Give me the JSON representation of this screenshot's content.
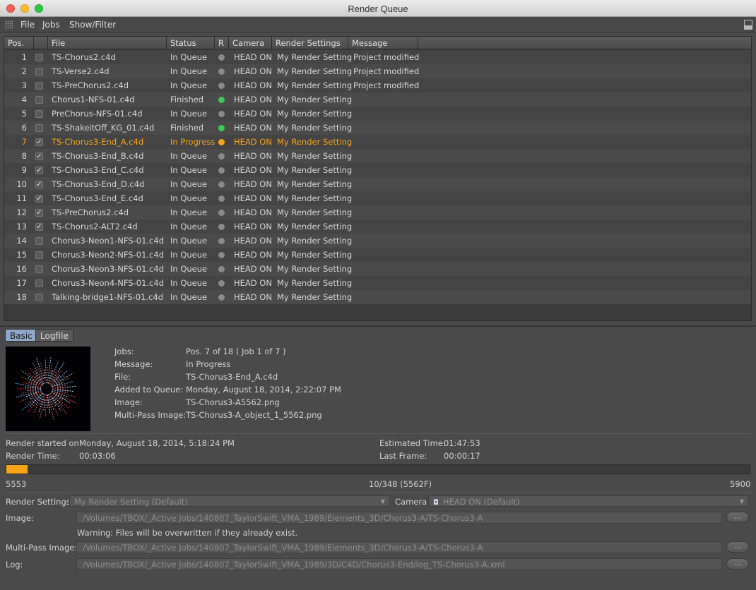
{
  "window": {
    "title": "Render Queue"
  },
  "menu": [
    "File",
    "Jobs",
    "Show/Filter"
  ],
  "columns": {
    "pos": "Pos.",
    "file": "File",
    "status": "Status",
    "r": "R",
    "camera": "Camera",
    "render_settings": "Render Settings",
    "message": "Message"
  },
  "colors": {
    "finished": "#3ec95a",
    "in_progress": "#f8a417",
    "queued": "#8a8a8a",
    "highlight": "#f8a417"
  },
  "jobs": [
    {
      "pos": "1",
      "checked": false,
      "file": "TS-Chorus2.c4d",
      "status": "In Queue",
      "state": "queued",
      "camera": "HEAD ON",
      "render_setting": "My Render Setting",
      "message": "Project modified"
    },
    {
      "pos": "2",
      "checked": false,
      "file": "TS-Verse2.c4d",
      "status": "In Queue",
      "state": "queued",
      "camera": "HEAD ON",
      "render_setting": "My Render Setting",
      "message": "Project modified"
    },
    {
      "pos": "3",
      "checked": false,
      "file": "TS-PreChorus2.c4d",
      "status": "In Queue",
      "state": "queued",
      "camera": "HEAD ON",
      "render_setting": "My Render Setting",
      "message": "Project modified"
    },
    {
      "pos": "4",
      "checked": false,
      "file": "Chorus1-NFS-01.c4d",
      "status": "Finished",
      "state": "finished",
      "camera": "HEAD ON",
      "render_setting": "My Render Setting",
      "message": ""
    },
    {
      "pos": "5",
      "checked": false,
      "file": "PreChorus-NFS-01.c4d",
      "status": "In Queue",
      "state": "queued",
      "camera": "HEAD ON",
      "render_setting": "My Render Setting",
      "message": ""
    },
    {
      "pos": "6",
      "checked": false,
      "file": "TS-ShakeitOff_KG_01.c4d",
      "status": "Finished",
      "state": "finished",
      "camera": "HEAD ON",
      "render_setting": "My Render Setting",
      "message": ""
    },
    {
      "pos": "7",
      "checked": true,
      "file": "TS-Chorus3-End_A.c4d",
      "status": "In Progress",
      "state": "in_progress",
      "camera": "HEAD ON",
      "render_setting": "My Render Setting",
      "message": ""
    },
    {
      "pos": "8",
      "checked": true,
      "file": "TS-Chorus3-End_B.c4d",
      "status": "In Queue",
      "state": "queued",
      "camera": "HEAD ON",
      "render_setting": "My Render Setting",
      "message": ""
    },
    {
      "pos": "9",
      "checked": true,
      "file": "TS-Chorus3-End_C.c4d",
      "status": "In Queue",
      "state": "queued",
      "camera": "HEAD ON",
      "render_setting": "My Render Setting",
      "message": ""
    },
    {
      "pos": "10",
      "checked": true,
      "file": "TS-Chorus3-End_D.c4d",
      "status": "In Queue",
      "state": "queued",
      "camera": "HEAD ON",
      "render_setting": "My Render Setting",
      "message": ""
    },
    {
      "pos": "11",
      "checked": true,
      "file": "TS-Chorus3-End_E.c4d",
      "status": "In Queue",
      "state": "queued",
      "camera": "HEAD ON",
      "render_setting": "My Render Setting",
      "message": ""
    },
    {
      "pos": "12",
      "checked": true,
      "file": "TS-PreChorus2.c4d",
      "status": "In Queue",
      "state": "queued",
      "camera": "HEAD ON",
      "render_setting": "My Render Setting",
      "message": ""
    },
    {
      "pos": "13",
      "checked": true,
      "file": "TS-Chorus2-ALT2.c4d",
      "status": "In Queue",
      "state": "queued",
      "camera": "HEAD ON",
      "render_setting": "My Render Setting",
      "message": ""
    },
    {
      "pos": "14",
      "checked": false,
      "file": "Chorus3-Neon1-NFS-01.c4d",
      "status": "In Queue",
      "state": "queued",
      "camera": "HEAD ON",
      "render_setting": "My Render Setting",
      "message": ""
    },
    {
      "pos": "15",
      "checked": false,
      "file": "Chorus3-Neon2-NFS-01.c4d",
      "status": "In Queue",
      "state": "queued",
      "camera": "HEAD ON",
      "render_setting": "My Render Setting",
      "message": ""
    },
    {
      "pos": "16",
      "checked": false,
      "file": "Chorus3-Neon3-NFS-01.c4d",
      "status": "In Queue",
      "state": "queued",
      "camera": "HEAD ON",
      "render_setting": "My Render Setting",
      "message": ""
    },
    {
      "pos": "17",
      "checked": false,
      "file": "Chorus3-Neon4-NFS-01.c4d",
      "status": "In Queue",
      "state": "queued",
      "camera": "HEAD ON",
      "render_setting": "My Render Setting",
      "message": ""
    },
    {
      "pos": "18",
      "checked": false,
      "file": "Talking-bridge1-NFS-01.c4d",
      "status": "In Queue",
      "state": "queued",
      "camera": "HEAD ON",
      "render_setting": "My Render Setting",
      "message": ""
    }
  ],
  "tabs": {
    "basic": "Basic",
    "logfile": "Logfile"
  },
  "details": [
    {
      "label": "Jobs:",
      "value": "Pos. 7 of 18 ( Job 1 of 7 )"
    },
    {
      "label": "Message:",
      "value": "In Progress"
    },
    {
      "label": "File:",
      "value": "TS-Chorus3-End_A.c4d"
    },
    {
      "label": "Added to Queue:",
      "value": "Monday, August 18, 2014, 2:22:07 PM"
    },
    {
      "label": "Image:",
      "value": "TS-Chorus3-A5562.png"
    },
    {
      "label": "Multi-Pass Image:",
      "value": "TS-Chorus3-A_object_1_5562.png"
    }
  ],
  "stats": {
    "render_started_label": "Render started on:",
    "render_started_value": "Monday, August 18, 2014, 5:18:24 PM",
    "render_time_label": "Render Time:",
    "render_time_value": "00:03:06",
    "estimated_label": "Estimated Time:",
    "estimated_value": "01:47:53",
    "last_frame_label": "Last Frame:",
    "last_frame_value": "00:00:17"
  },
  "progress": {
    "fraction": 0.0287,
    "start": "5553",
    "center": "10/348 (5562F)",
    "end": "5900"
  },
  "settings": {
    "render_settings_label": "Render Settings",
    "render_settings_value": "My Render Setting (Default)",
    "camera_label": "Camera",
    "camera_value": "HEAD ON (Default)",
    "camera_icon": "camera-icon",
    "image_label": "Image:",
    "image_path": "/Volumes/TBOX/_Active Jobs/140807_TaylorSwift_VMA_1989/Elements_3D/Chorus3-A/TS-Chorus3-A",
    "warning": "Warning: Files will be overwritten if they already exist.",
    "multipass_label": "Multi-Pass Image:",
    "multipass_path": "/Volumes/TBOX/_Active Jobs/140807_TaylorSwift_VMA_1989/Elements_3D/Chorus3-A/TS-Chorus3-A",
    "log_label": "Log:",
    "log_path": "/Volumes/TBOX/_Active Jobs/140807_TaylorSwift_VMA_1989/3D/C4D/Chorus3-End/log_TS-Chorus3-A.xml",
    "browse_label": "..."
  }
}
